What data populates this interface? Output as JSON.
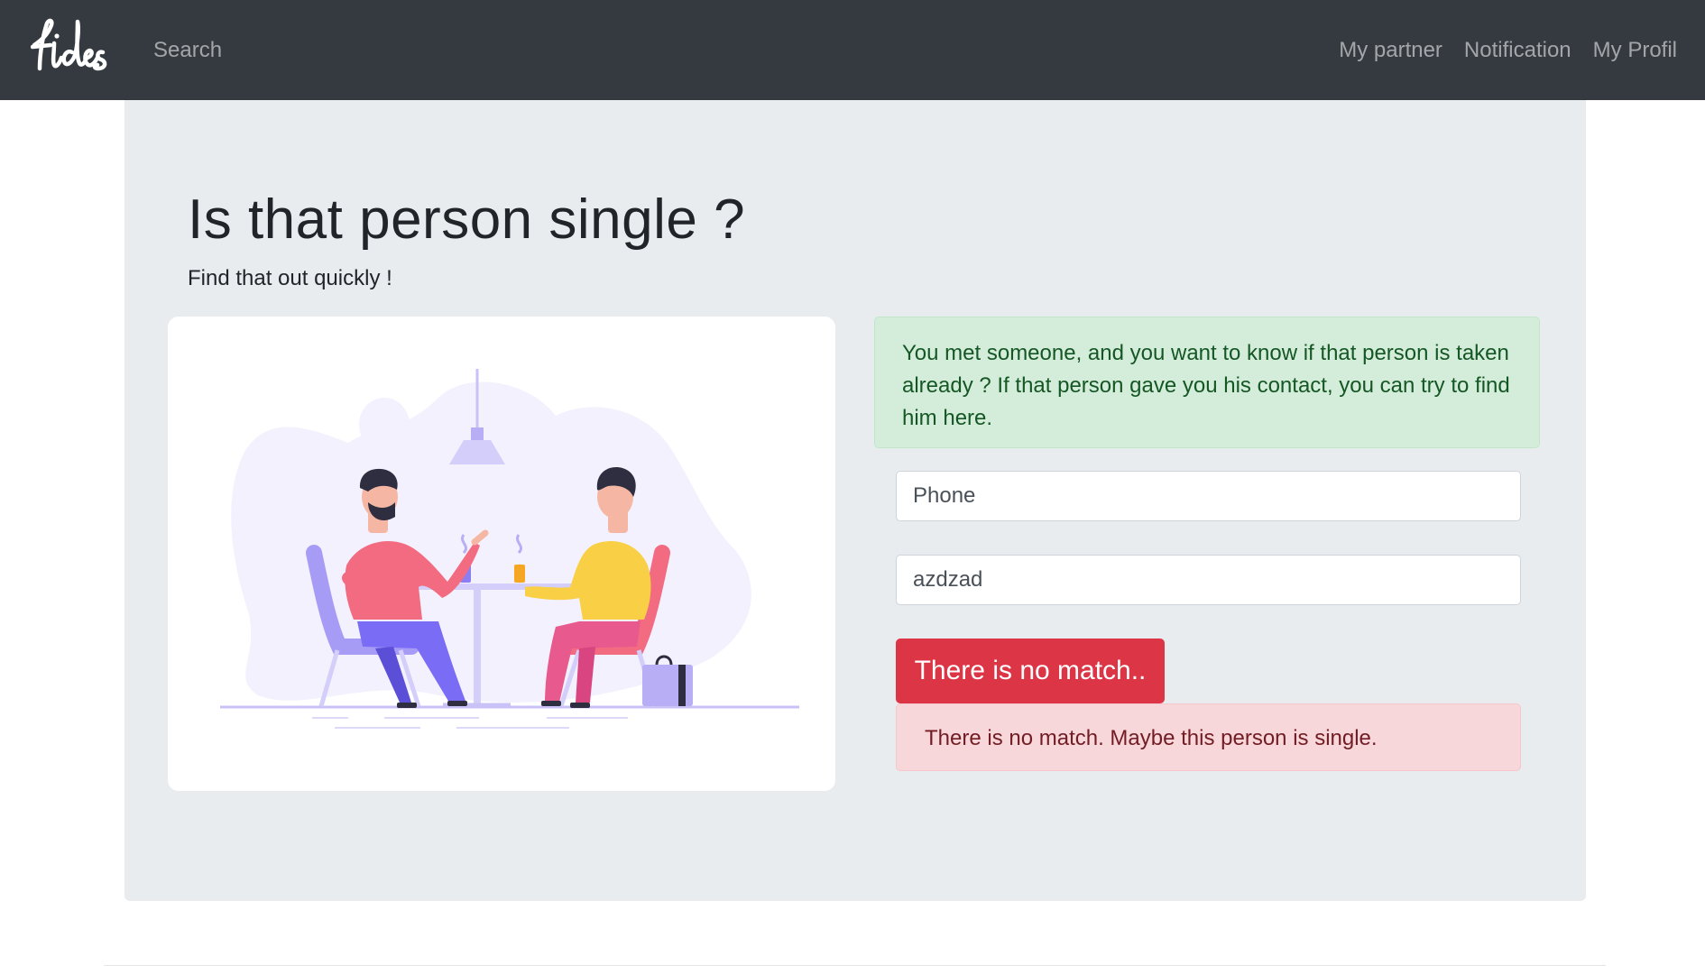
{
  "navbar": {
    "brand": "fides",
    "search_label": "Search",
    "links": [
      "My partner",
      "Notification",
      "My Profil"
    ]
  },
  "hero": {
    "title": "Is that person single ?",
    "subtitle": "Find that out quickly !"
  },
  "info_alert": {
    "text": "You met someone, and you want to know if that person is taken already ? If that person gave you his contact, you can try to find him here."
  },
  "form": {
    "phone_placeholder": "Phone",
    "name_value": "azdzad",
    "button_label": "There is no match.."
  },
  "result_alert": {
    "text": "There is no match. Maybe this person is single."
  },
  "colors": {
    "navbar_bg": "#343a40",
    "jumbotron_bg": "#e9ecef",
    "success_bg": "#d4edda",
    "danger": "#dc3545",
    "danger_bg": "#f8d7da",
    "illustration_accent": "#7b6cf6"
  },
  "illustration": {
    "description_icon": "two-people-at-cafe-table-illustration"
  }
}
